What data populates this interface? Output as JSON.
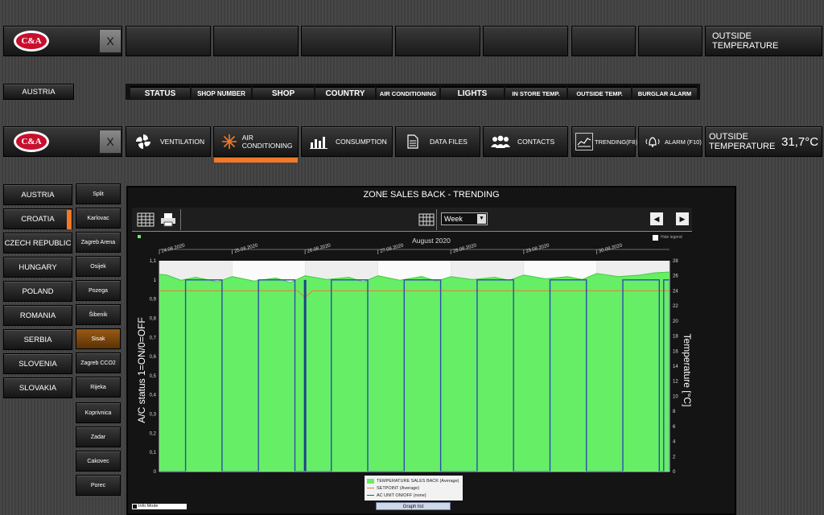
{
  "brand": {
    "logo_text": "C&A",
    "close_label": "X"
  },
  "outside_top": {
    "label": "OUTSIDE TEMPERATURE"
  },
  "left_country": "AUSTRIA",
  "columns": [
    "STATUS",
    "SHOP NUMBER",
    "SHOP",
    "COUNTRY",
    "AIR CONDITIONING",
    "LIGHTS",
    "IN STORE TEMP.",
    "OUTSIDE TEMP.",
    "BURGLAR ALARM"
  ],
  "nav": [
    {
      "label": "VENTILATION",
      "icon": "fan-icon"
    },
    {
      "label": "AIR CONDITIONING",
      "icon": "snowflake-icon"
    },
    {
      "label": "CONSUMPTION",
      "icon": "bar-chart-icon"
    },
    {
      "label": "DATA FILES",
      "icon": "document-icon"
    },
    {
      "label": "CONTACTS",
      "icon": "people-icon"
    },
    {
      "label": "TRENDING(F8)",
      "icon": "trend-icon"
    },
    {
      "label": "ALARM (F10)",
      "icon": "bell-icon"
    }
  ],
  "outside": {
    "label": "OUTSIDE TEMPERATURE",
    "value": "31,7°C"
  },
  "countries": [
    "AUSTRIA",
    "CROATIA",
    "CZECH REPUBLIC",
    "HUNGARY",
    "POLAND",
    "ROMANIA",
    "SERBIA",
    "SLOVENIA",
    "SLOVAKIA"
  ],
  "cities": [
    "Split",
    "Karlovac",
    "Zagreb Arena",
    "Osijek",
    "Pozega",
    "Šibenik",
    "Sisak",
    "Zagreb CCO2",
    "Rijeka",
    "Koprivnica",
    "Zadar",
    "Cakovec",
    "Porec"
  ],
  "selected_country": "CROATIA",
  "selected_city": "Sisak",
  "trend": {
    "title": "ZONE SALES BACK - TRENDING",
    "range_value": "Week",
    "month_label": "August 2020",
    "legend_toggle": "Hide legend",
    "info_mode": "Info Mode",
    "graph_list": "Graph list",
    "legend": [
      "TEMPERATURE SALES BACK (Average)",
      "SETPOINT (Average)",
      "AC UNIT ON/OFF (none)"
    ]
  },
  "chart_data": {
    "type": "area",
    "x_dates": [
      "24.08.2020",
      "25.08.2020",
      "26.08.2020",
      "27.08.2020",
      "28.08.2020",
      "29.08.2020",
      "30.08.2020"
    ],
    "ylabel_left": "A/C status 1=ON/0=OFF",
    "ylabel_right": "Temperature [°C]",
    "ylim_left": [
      0,
      1.1
    ],
    "ylim_right": [
      0,
      28
    ],
    "yticks_left": [
      "0",
      "0,1",
      "0,2",
      "0,3",
      "0,4",
      "0,5",
      "0,6",
      "0,7",
      "0,8",
      "0,9",
      "1",
      "1,1"
    ],
    "yticks_right": [
      "0",
      "2",
      "4",
      "6",
      "8",
      "10",
      "12",
      "14",
      "16",
      "18",
      "20",
      "22",
      "24",
      "26",
      "28"
    ],
    "series": [
      {
        "name": "TEMPERATURE SALES BACK (Average)",
        "color": "#66ee66",
        "x_days": [
          0,
          0.1,
          0.3,
          0.5,
          0.8,
          1.0,
          1.3,
          1.6,
          1.8,
          2.0,
          2.3,
          2.6,
          2.8,
          3.0,
          3.3,
          3.6,
          3.8,
          4.0,
          4.3,
          4.6,
          4.8,
          5.0,
          5.3,
          5.6,
          5.8,
          6.0,
          6.3,
          6.6,
          6.8,
          7.0
        ],
        "values": [
          26.2,
          26.1,
          25.4,
          25.8,
          25.2,
          25.9,
          25.3,
          25.7,
          25.1,
          26.0,
          25.5,
          25.8,
          25.2,
          26.0,
          25.4,
          25.9,
          25.3,
          25.9,
          25.5,
          25.8,
          25.4,
          26.1,
          25.6,
          25.9,
          25.5,
          26.3,
          25.9,
          26.1,
          26.4,
          26.5
        ]
      },
      {
        "name": "SETPOINT (Average)",
        "color": "#e87a30",
        "x_days": [
          0,
          1.9,
          2.0,
          2.1,
          7.0
        ],
        "values": [
          24.0,
          24.0,
          23.1,
          24.0,
          24.0
        ]
      },
      {
        "name": "AC UNIT ON/OFF (none)",
        "color": "#2a4fa8",
        "on_intervals": [
          [
            0.36,
            0.86
          ],
          [
            1.36,
            1.86
          ],
          [
            2.36,
            2.86
          ],
          [
            3.36,
            3.86
          ],
          [
            4.36,
            4.86
          ],
          [
            5.36,
            5.86
          ],
          [
            6.36,
            6.86
          ],
          [
            6.92,
            7.0
          ]
        ]
      }
    ]
  }
}
